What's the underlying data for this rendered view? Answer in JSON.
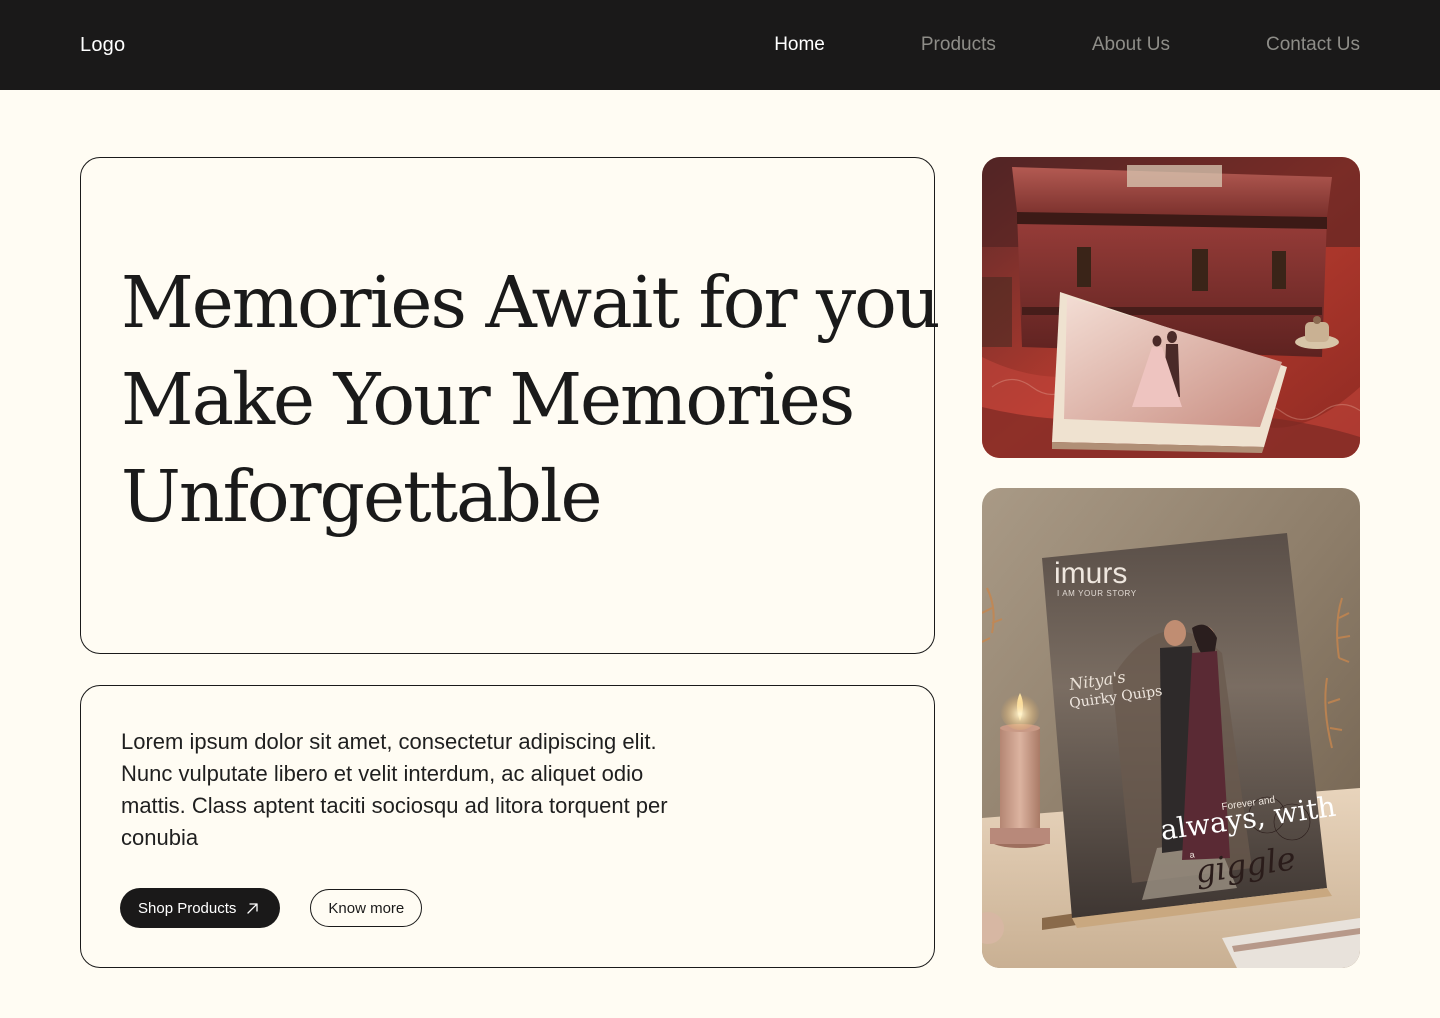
{
  "nav": {
    "logo": "Logo",
    "links": [
      {
        "label": "Home",
        "active": true
      },
      {
        "label": "Products",
        "active": false
      },
      {
        "label": "About Us",
        "active": false
      },
      {
        "label": "Contact Us",
        "active": false
      }
    ]
  },
  "hero": {
    "title_lines": [
      "Memories Await for you",
      "Make Your Memories",
      "Unforgettable"
    ]
  },
  "intro": {
    "text": "Lorem ipsum dolor sit amet, consectetur adipiscing elit. Nunc vulputate libero et velit interdum, ac aliquet odio mattis. Class aptent taciti sociosqu ad litora torquent per conubia",
    "primary_button": "Shop Products",
    "primary_icon": "arrow-up-right-icon",
    "secondary_button": "Know more"
  },
  "magazine": {
    "brand": "imurs",
    "tagline": "I AM YOUR STORY",
    "script_name": "Nitya's",
    "feature": "Quirky Quips",
    "kicker": "Forever and",
    "headline": "always, with",
    "small_word": "a",
    "script_word": "giggle"
  },
  "colors": {
    "nav_background": "#1a1919",
    "page_background": "#fffcf3",
    "nav_active": "#ffffff",
    "nav_inactive": "#8e8d88"
  }
}
